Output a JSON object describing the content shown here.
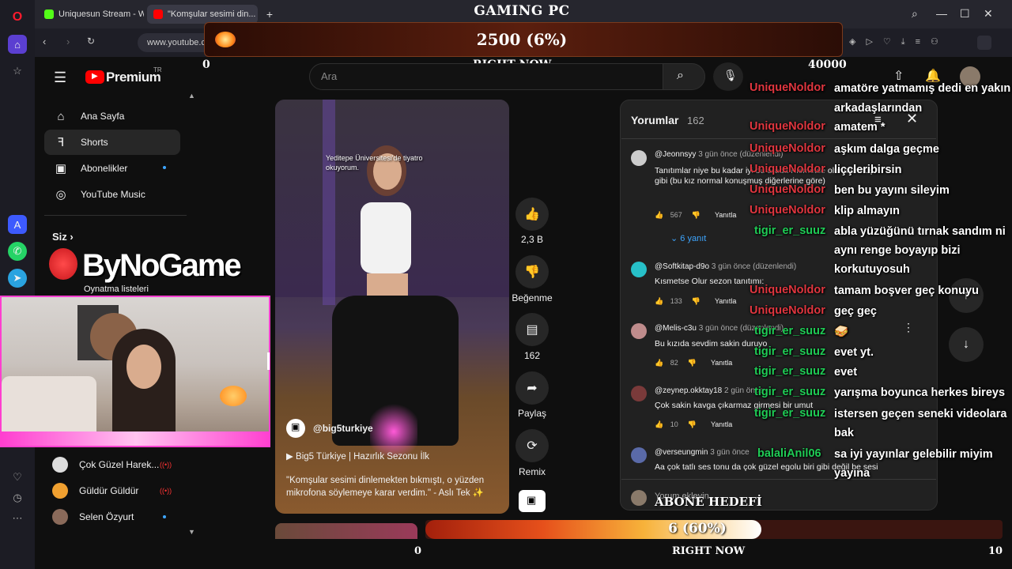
{
  "browser": {
    "tabs": [
      {
        "label": "Uniquesun Stream - Watch"
      },
      {
        "label": "\"Komşular sesimi din..."
      }
    ],
    "url": "www.youtube.c"
  },
  "overlay": {
    "title": "GAMING PC",
    "top_goal": {
      "value_text": "2500 (6%)",
      "min": "0",
      "max": "40000",
      "caption": "RIGHT NOW",
      "fraction": 0.06
    },
    "bottom_goal": {
      "label": "ABONE HEDEFİ",
      "value_text": "6 (60%)",
      "min": "0",
      "max": "10",
      "caption": "RIGHT NOW",
      "fraction": 0.6
    },
    "watermark": "ByNoGame"
  },
  "youtube": {
    "logo_text": "Premium",
    "logo_sup": "TR",
    "search_placeholder": "Ara",
    "nav": [
      {
        "label": "Ana Sayfa",
        "icon": "home-icon"
      },
      {
        "label": "Shorts",
        "icon": "shorts-icon"
      },
      {
        "label": "Abonelikler",
        "icon": "subscriptions-icon"
      },
      {
        "label": "YouTube Music",
        "icon": "music-icon"
      }
    ],
    "you_label": "Siz",
    "playlists_label": "Oynatma listeleri",
    "subs": [
      {
        "label": "Çok Güzel Harek..."
      },
      {
        "label": "Güldür Güldür"
      },
      {
        "label": "Selen Özyurt"
      }
    ]
  },
  "short": {
    "overlay_text": "Yeditepe Üniversitesi'de tiyatro okuyorum.",
    "channel": "@big5turkiye",
    "playlist": "Big5 Türkiye | Hazırlık Sezonu İlk",
    "caption": "\"Komşular sesimi dinlemekten bıkmıştı, o yüzden mikrofona söylemeye karar verdim.\" - Aslı Tek ✨",
    "actions": {
      "likes": "2,3 B",
      "dislike": "Beğenme",
      "comments": "162",
      "share": "Paylaş",
      "remix": "Remix"
    }
  },
  "comments": {
    "title": "Yorumlar",
    "count": "162",
    "reply_label": "Yanıtla",
    "add_placeholder": "Yorum ekleyin...",
    "items": [
      {
        "user": "@Jeonnsyy",
        "meta": "3 gün önce (düzenlendi)",
        "text": "Tanıtımlar niye bu kadar iyi bu arada Kısmetse olur olurmuş gibi (bu kız normal konuşmuş diğerlerine göre)",
        "likes": "567"
      },
      {
        "user": "@Softkitap-d9o",
        "meta": "3 gün önce (düzenlendi)",
        "text": "Kısmetse Olur sezon tanıtımı:",
        "likes": "133"
      },
      {
        "user": "@Melis-c3u",
        "meta": "3 gün önce (düzenlendi)",
        "text": "Bu kızıda sevdim sakin duruyo",
        "likes": "82"
      },
      {
        "user": "@zeynep.okktay18",
        "meta": "2 gün önce",
        "text": "Çok sakin kavga çıkarmaz girmesi bir umut",
        "likes": "10"
      },
      {
        "user": "@verseungmin",
        "meta": "3 gün önce",
        "text": "Aa çok tatlı ses tonu da çok güzel egolu biri gibi değil be sesi",
        "likes": ""
      }
    ],
    "replies_label": "6 yanıt"
  },
  "chat": [
    {
      "name": "UniqueNoldor",
      "color": "#e0363f",
      "msg": "amatöre yatmamış dedi en yakın"
    },
    {
      "name": "",
      "color": "#e0363f",
      "msg": "arkadaşlarından"
    },
    {
      "name": "UniqueNoldor",
      "color": "#e0363f",
      "msg": "amatem *"
    },
    {
      "name": "UniqueNoldor",
      "color": "#e0363f",
      "msg": "aşkım dalga geçme"
    },
    {
      "name": "UniqueNoldor",
      "color": "#e0363f",
      "msg": "liççleribirsin"
    },
    {
      "name": "UniqueNoldor",
      "color": "#e0363f",
      "msg": "ben bu yayını sileyim"
    },
    {
      "name": "UniqueNoldor",
      "color": "#e0363f",
      "msg": "klip almayın"
    },
    {
      "name": "tigir_er_suuz",
      "color": "#1fcc55",
      "msg": "abla yüzüğünü tırnak sandım ni"
    },
    {
      "name": "",
      "color": "#1fcc55",
      "msg": "aynı renge boyayıp bizi"
    },
    {
      "name": "",
      "color": "#1fcc55",
      "msg": "korkutuyosuh"
    },
    {
      "name": "UniqueNoldor",
      "color": "#e0363f",
      "msg": "tamam boşver geç konuyu"
    },
    {
      "name": "UniqueNoldor",
      "color": "#e0363f",
      "msg": "geç geç"
    },
    {
      "name": "tigir_er_suuz",
      "color": "#1fcc55",
      "msg": "🥪"
    },
    {
      "name": "tigir_er_suuz",
      "color": "#1fcc55",
      "msg": "evet yt."
    },
    {
      "name": "tigir_er_suuz",
      "color": "#1fcc55",
      "msg": "evet"
    },
    {
      "name": "tigir_er_suuz",
      "color": "#1fcc55",
      "msg": "yarışma boyunca herkes bireys"
    },
    {
      "name": "tigir_er_suuz",
      "color": "#1fcc55",
      "msg": "istersen geçen seneki videolara"
    },
    {
      "name": "",
      "color": "#1fcc55",
      "msg": "bak"
    },
    {
      "name": "balaliAnil06",
      "color": "#1fcc55",
      "msg": "sa iyi yayınlar gelebilir miyim"
    },
    {
      "name": "",
      "color": "#1fcc55",
      "msg": "yayına"
    }
  ]
}
